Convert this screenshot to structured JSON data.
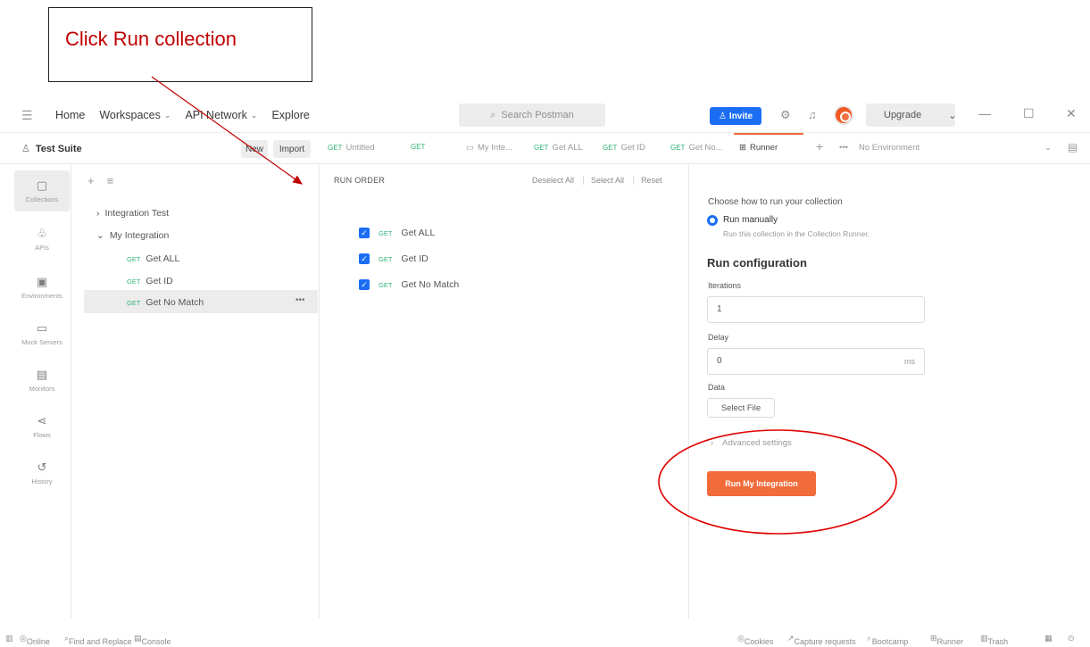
{
  "annotation": {
    "text": "Click Run collection",
    "color": "#c00000"
  },
  "topbar": {
    "menu_icon": "hamburger-icon",
    "nav": [
      {
        "label": "Home",
        "dropdown": false
      },
      {
        "label": "Workspaces",
        "dropdown": true
      },
      {
        "label": "API Network",
        "dropdown": true
      },
      {
        "label": "Explore",
        "dropdown": false
      }
    ],
    "search_placeholder": "Search Postman",
    "invite_label": "Invite",
    "upgrade_label": "Upgrade"
  },
  "workspace": {
    "name": "Test Suite",
    "new_label": "New",
    "import_label": "Import",
    "tabs": [
      {
        "method": "GET",
        "label": "Untitled"
      },
      {
        "method": "GET",
        "label": ""
      },
      {
        "method": "",
        "label": "My Inte..."
      },
      {
        "method": "GET",
        "label": "Get ALL"
      },
      {
        "method": "GET",
        "label": "Get ID"
      },
      {
        "method": "GET",
        "label": "Get No..."
      },
      {
        "method": "",
        "label": "Runner"
      }
    ],
    "environment": "No Environment"
  },
  "rail": [
    {
      "label": "Collections",
      "icon": "collections-icon"
    },
    {
      "label": "APIs",
      "icon": "apis-icon"
    },
    {
      "label": "Environments",
      "icon": "environments-icon"
    },
    {
      "label": "Mock Servers",
      "icon": "mock-servers-icon"
    },
    {
      "label": "Monitors",
      "icon": "monitors-icon"
    },
    {
      "label": "Flows",
      "icon": "flows-icon"
    },
    {
      "label": "History",
      "icon": "history-icon"
    }
  ],
  "tree": {
    "collections": [
      {
        "label": "Integration Test",
        "expanded": false
      },
      {
        "label": "My Integration",
        "expanded": true
      }
    ],
    "requests": [
      {
        "method": "GET",
        "label": "Get ALL"
      },
      {
        "method": "GET",
        "label": "Get ID"
      },
      {
        "method": "GET",
        "label": "Get No Match"
      }
    ]
  },
  "run_order": {
    "heading": "RUN ORDER",
    "deselect_all": "Deselect All",
    "select_all": "Select All",
    "reset": "Reset",
    "items": [
      {
        "method": "GET",
        "label": "Get ALL",
        "checked": true
      },
      {
        "method": "GET",
        "label": "Get ID",
        "checked": true
      },
      {
        "method": "GET",
        "label": "Get No Match",
        "checked": true
      }
    ]
  },
  "config": {
    "choose_label": "Choose how to run your collection",
    "run_manually": "Run manually",
    "run_manually_sub": "Run this collection in the Collection Runner.",
    "title": "Run configuration",
    "iterations_label": "Iterations",
    "iterations_value": "1",
    "delay_label": "Delay",
    "delay_value": "0",
    "delay_unit": "ms",
    "data_label": "Data",
    "select_file": "Select File",
    "advanced": "Advanced settings",
    "run_button": "Run My Integration",
    "accent": "#f26b3a"
  },
  "statusbar": {
    "online": "Online",
    "find_replace": "Find and Replace",
    "console": "Console",
    "cookies": "Cookies",
    "capture": "Capture requests",
    "bootcamp": "Bootcamp",
    "runner": "Runner",
    "trash": "Trash"
  }
}
